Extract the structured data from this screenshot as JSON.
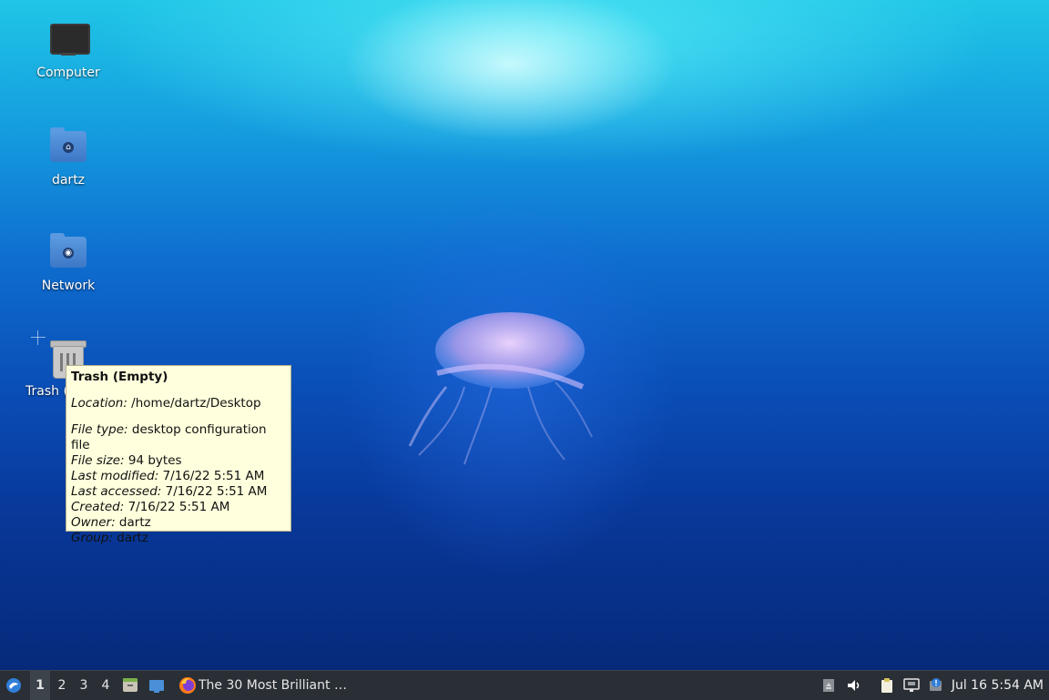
{
  "desktop": {
    "icons": [
      {
        "label": "Computer",
        "icon": "computer-icon"
      },
      {
        "label": "dartz",
        "icon": "home-folder-icon"
      },
      {
        "label": "Network",
        "icon": "network-folder-icon"
      },
      {
        "label": "Trash (",
        "icon": "trash-icon"
      }
    ]
  },
  "tooltip": {
    "title": "Trash (Empty)",
    "location_key": "Location:",
    "location_val": " /home/dartz/Desktop",
    "file_type_key": "File type:",
    "file_type_val": " desktop configuration file",
    "file_size_key": "File size:",
    "file_size_val": " 94 bytes",
    "modified_key": "Last modified:",
    "modified_val": " 7/16/22 5:51 AM",
    "accessed_key": "Last accessed:",
    "accessed_val": " 7/16/22 5:51 AM",
    "created_key": "Created:",
    "created_val": " 7/16/22 5:51 AM",
    "owner_key": "Owner:",
    "owner_val": " dartz",
    "group_key": "Group:",
    "group_val": " dartz"
  },
  "taskbar": {
    "workspaces": [
      "1",
      "2",
      "3",
      "4"
    ],
    "active_workspace": "1",
    "window_title": "The 30 Most Brilliant …",
    "clock": "Jul 16  5:54 AM",
    "tray_icons": [
      "eject-icon",
      "volume-icon",
      "clipboard-icon",
      "network-wired-icon",
      "update-notifier-icon"
    ]
  }
}
